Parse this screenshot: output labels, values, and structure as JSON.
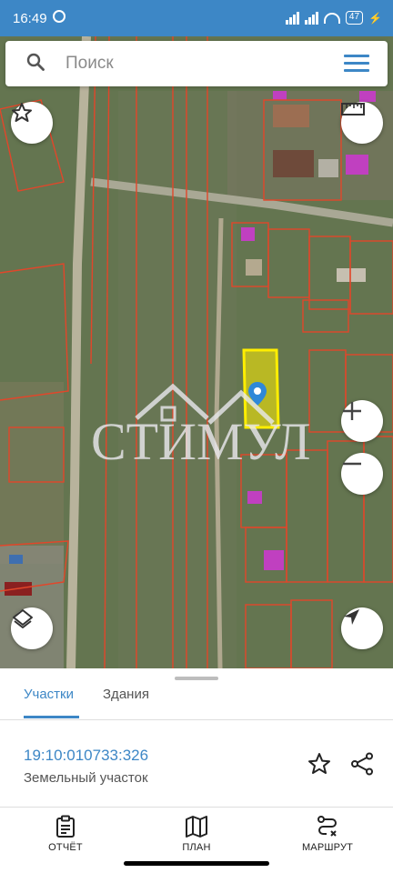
{
  "status": {
    "time": "16:49",
    "battery": "47"
  },
  "search": {
    "placeholder": "Поиск"
  },
  "map": {
    "watermark": "СТИМУЛ"
  },
  "tabs": [
    {
      "label": "Участки",
      "active": true
    },
    {
      "label": "Здания",
      "active": false
    }
  ],
  "parcel": {
    "number": "19:10:010733:326",
    "type": "Земельный участок"
  },
  "nav": [
    {
      "label": "ОТЧЁТ",
      "icon": "clipboard-icon"
    },
    {
      "label": "ПЛАН",
      "icon": "map-icon"
    },
    {
      "label": "МАРШРУТ",
      "icon": "route-icon"
    }
  ],
  "colors": {
    "accent": "#3d87c6",
    "selected_parcel": "#ffee00",
    "parcel_outline": "#e2462a"
  }
}
